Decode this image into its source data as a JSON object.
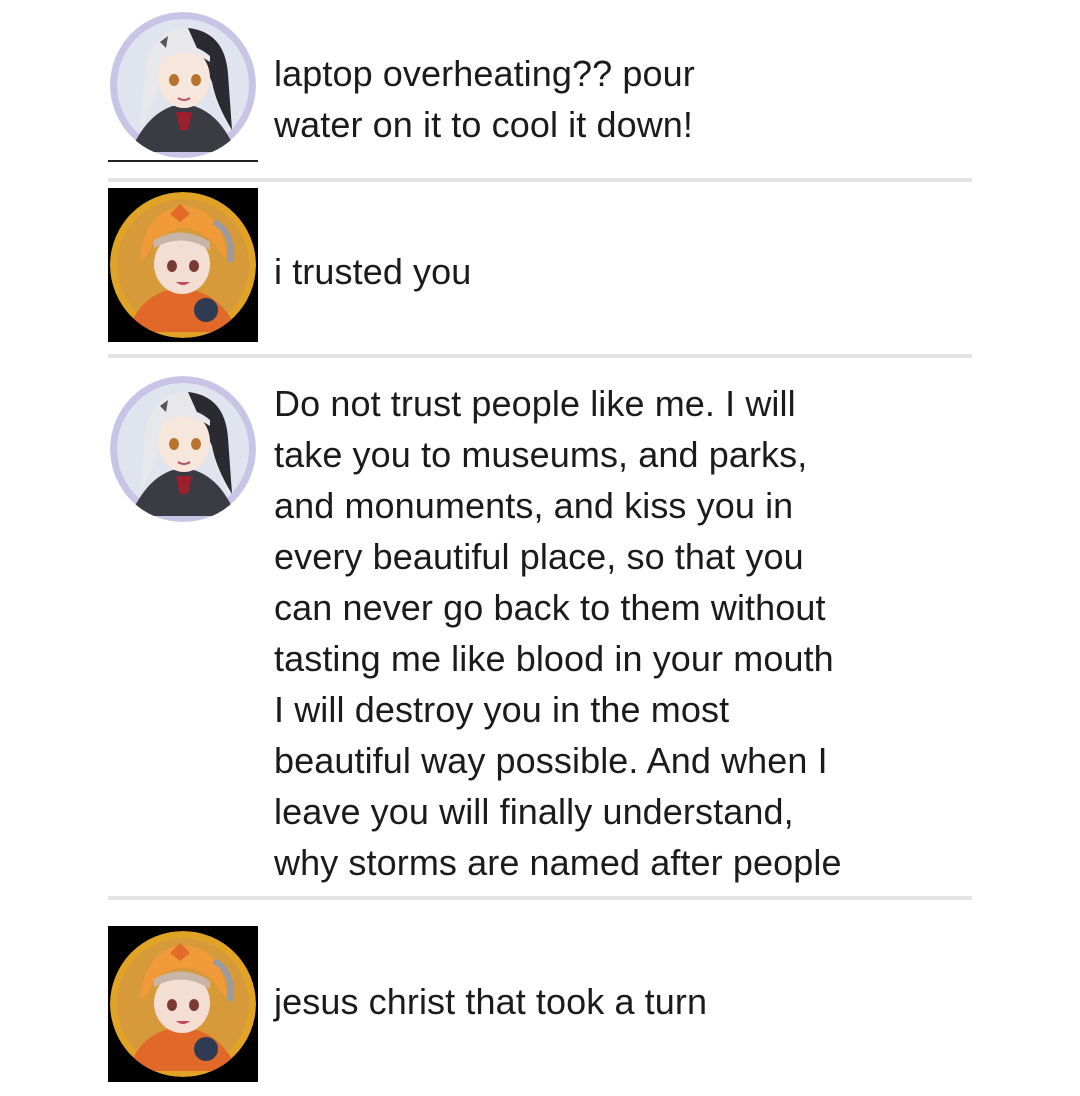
{
  "thread": {
    "posts": [
      {
        "author": "grey-hair-avatar",
        "text": "laptop overheating?? pour\nwater on it to cool it down!"
      },
      {
        "author": "orange-hood-avatar",
        "text": "i trusted you"
      },
      {
        "author": "grey-hair-avatar",
        "text": "Do not trust people like me. I will\ntake you to museums, and parks,\nand monuments, and kiss you in\nevery beautiful place, so that you\ncan never go back to them without\ntasting me like blood in your mouth\nI will destroy you in the most\nbeautiful way possible. And when I\nleave you will finally understand,\nwhy storms are named after people"
      },
      {
        "author": "orange-hood-avatar",
        "text": "jesus christ that took a turn"
      }
    ]
  },
  "colors": {
    "divider": "#e4e4e4",
    "text": "#1b1b1b",
    "grey_avatar_ring": "#b9b3d9",
    "orange_avatar_ring": "#e0a326"
  }
}
